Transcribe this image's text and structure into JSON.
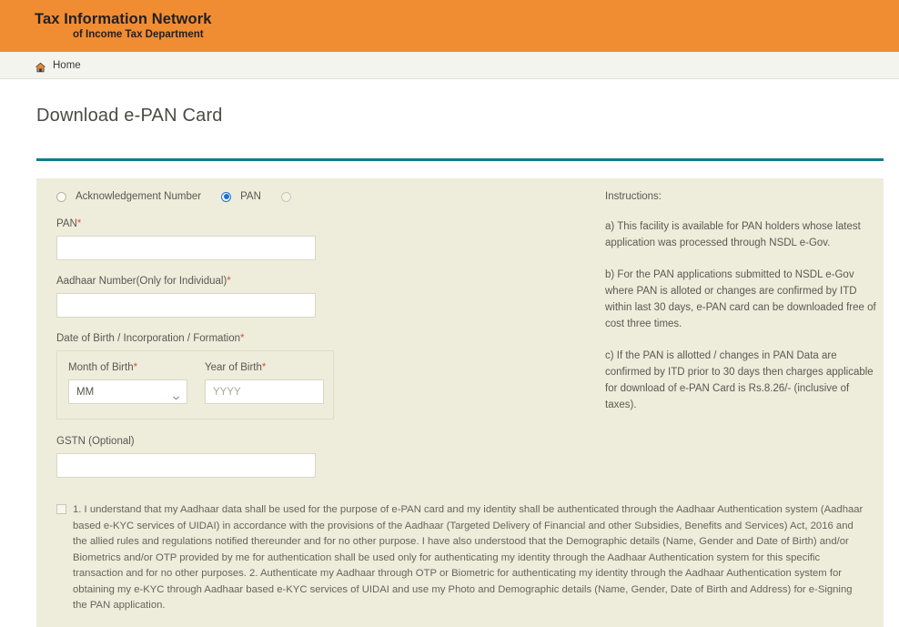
{
  "header": {
    "brand_line1": "Tax Information Network",
    "brand_line2": "of Income Tax Department",
    "bg_color": "#f08c32"
  },
  "breadcrumb": {
    "home_label": "Home",
    "home_icon": "home-icon"
  },
  "page": {
    "title": "Download e-PAN Card",
    "rule_color": "#0d7d8c",
    "panel_bg": "#eeeddc"
  },
  "form": {
    "mode_options": [
      {
        "label": "Acknowledgement Number",
        "selected": false
      },
      {
        "label": "PAN",
        "selected": true
      },
      {
        "label": "",
        "selected": false
      }
    ],
    "pan": {
      "label": "PAN",
      "required": "*",
      "value": "",
      "placeholder": ""
    },
    "aadhaar": {
      "label": "Aadhaar Number(Only for Individual)",
      "required": "*",
      "value": "",
      "placeholder": ""
    },
    "dob": {
      "group_label": "Date of Birth / Incorporation / Formation",
      "required": "*",
      "month": {
        "label": "Month of Birth",
        "required": "*",
        "value": "MM",
        "icon": "chevron-down-icon"
      },
      "year": {
        "label": "Year of Birth",
        "required": "*",
        "value": "",
        "placeholder": "YYYY"
      }
    },
    "gstn": {
      "label": "GSTN (Optional)",
      "value": "",
      "placeholder": ""
    },
    "consent": {
      "checked": false,
      "text": "1. I understand that my Aadhaar data shall be used for the purpose of e-PAN card and my identity shall be authenticated through the Aadhaar Authentication system (Aadhaar based e-KYC services of UIDAI) in accordance with the provisions of the Aadhaar (Targeted Delivery of Financial and other Subsidies, Benefits and Services) Act, 2016 and the allied rules and regulations notified thereunder and for no other purpose. I have also understood that the Demographic details (Name, Gender and Date of Birth) and/or Biometrics and/or OTP provided by me for authentication shall be used only for authenticating my identity through the Aadhaar Authentication system for this specific transaction and for no other purposes. 2. Authenticate my Aadhaar through OTP or Biometric for authenticating my identity through the Aadhaar Authentication system for obtaining my e-KYC through Aadhaar based e-KYC services of UIDAI and use my Photo and Demographic details (Name, Gender, Date of Birth and Address) for e-Signing the PAN application."
    }
  },
  "instructions": {
    "heading": "Instructions:",
    "items": [
      "a) This facility is available for PAN holders whose latest application was processed through NSDL e-Gov.",
      "b) For the PAN applications submitted to NSDL e-Gov where PAN is alloted or changes are confirmed by ITD within last 30 days, e-PAN card can be downloaded free of cost three times.",
      "c) If the PAN is allotted / changes in PAN Data are confirmed by ITD prior to 30 days then charges applicable for download of e-PAN Card is Rs.8.26/- (inclusive of taxes)."
    ]
  }
}
